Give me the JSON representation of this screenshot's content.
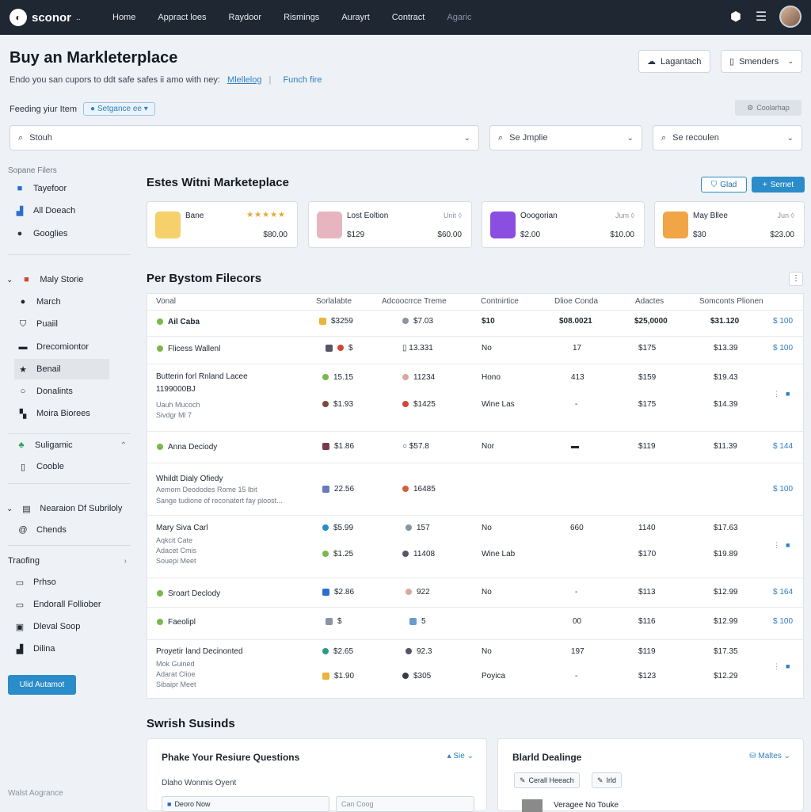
{
  "nav": {
    "brand": "sconor",
    "brand_suffix": "..",
    "links": [
      "Home",
      "Appract loes",
      "Raydoor",
      "Rismings",
      "Aurayrt",
      "Contract",
      "Agaric"
    ]
  },
  "header": {
    "title": "Buy an Markleterplace",
    "subtitle": "Endo you san cupors to ddt safe safes ii amo with ney:",
    "link1": "Mlellelog",
    "link2": "Funch fire",
    "btn1": "Lagantach",
    "btn2": "Smenders"
  },
  "filters": {
    "label": "Feeding yiur Item",
    "pill": "Setgance ee",
    "clear": "Coolarhap"
  },
  "search": {
    "s1": "Stouh",
    "s2": "Se Jmplie",
    "s3": "Se recoulen"
  },
  "sidebar": {
    "head1": "Sopane Filers",
    "items1": [
      "Tayefoor",
      "All Doeach",
      "Googlies"
    ],
    "group2": "Maly Storie",
    "items2": [
      "March",
      "Puaiil",
      "Drecomiontor",
      "Benail",
      "Donalints",
      "Moira Biorees"
    ],
    "group3": "Suligamic",
    "items3": [
      "Cooble"
    ],
    "group4": "Nearaion Df Subriloly",
    "items4": [
      "Chends"
    ],
    "head5": "Traofing",
    "items5": [
      "Prhso",
      "Endorall Folliober",
      "Dleval Soop",
      "Dilina"
    ],
    "button": "Ulid Autamot",
    "footer": "Walst Aogrance"
  },
  "market": {
    "title": "Estes Witni Marketeplace",
    "btn1": "Glad",
    "btn2": "Sernet",
    "cards": [
      {
        "name": "Bane",
        "tag": "★★★★★",
        "p1": "",
        "p2": "$80.00",
        "color": "#f3b23a"
      },
      {
        "name": "Lost Eoltion",
        "tag": "Unit ◊",
        "p1": "$129",
        "p2": "$60.00",
        "color": "#c9607a"
      },
      {
        "name": "Ooogorian",
        "tag": "Jum ◊",
        "p1": "$2.00",
        "p2": "$10.00",
        "color": "#8a3fd8"
      },
      {
        "name": "May Bllee",
        "tag": "Jun ◊",
        "p1": "$30",
        "p2": "$23.00",
        "color": "#e89a3a"
      }
    ]
  },
  "table": {
    "title": "Per Bystom Filecors",
    "headers": [
      "Vonal",
      "Sorlalabte",
      "Adcoocrrce Treme",
      "Contnirtice",
      "Dlioe Conda",
      "Adactes",
      "Somconts Plionen"
    ],
    "rows": [
      {
        "name": "Ail Caba",
        "c1": "$3259",
        "c2": "$7.03",
        "c3": "$10",
        "c4": "$08.0021",
        "c5": "$25,0000",
        "c6": "$31.120",
        "c7": "$ 100",
        "bold": true
      },
      {
        "name": "Flicess Wallenl",
        "c1": "$",
        "c2": "13.331",
        "c3": "No",
        "c4": "17",
        "c5": "$175",
        "c6": "$13.39",
        "c7": "$ 100"
      },
      {
        "name": "Butterin forl Rnland Lacee",
        "sub1": "1199000BJ",
        "sub2": "Uauh Mucoch",
        "sub3": "Sivdgr Ml 7",
        "c1": "15.15",
        "c2": "11234",
        "c3": "Hono",
        "c4": "413",
        "c5": "$159",
        "c6": "$19.43",
        "c1b": "$1.93",
        "c2b": "$1425",
        "c3b": "Wine Las",
        "c4b": "-",
        "c5b": "$175",
        "c6b": "$14.39"
      },
      {
        "name": "Anna Deciody",
        "c1": "$1.86",
        "c2": "$57.8",
        "c3": "Nor",
        "c4": "▬",
        "c5": "$119",
        "c6": "$11.39",
        "c7": "$ 144"
      },
      {
        "name": "Whildt Dialy Ofiedy",
        "sub1": "Aemom Deododes Rome 15 lbit",
        "sub2": "Sange tudione of reconatert fay ploost...",
        "c1": "22.56",
        "c2": "16485",
        "c7": "$ 100"
      },
      {
        "name": "Mary Siva Carl",
        "sub1": "Aqkcit Cate",
        "sub2": "Adacet Cmis",
        "sub3": "Souepi Meet",
        "c1": "$5.99",
        "c2": "157",
        "c3": "No",
        "c4": "660",
        "c5": "1140",
        "c6": "$17.63",
        "c1b": "$1.25",
        "c2b": "11408",
        "c3b": "Wine Lab",
        "c4b": "",
        "c5b": "$170",
        "c6b": "$19.89"
      },
      {
        "name": "Sroart Declody",
        "c1": "$2.86",
        "c2": "922",
        "c3": "No",
        "c4": "-",
        "c5": "$113",
        "c6": "$12.99",
        "c7": "$ 164"
      },
      {
        "name": "Faeolipl",
        "c1": "$",
        "c2": "5",
        "c3": "",
        "c4": "00",
        "c5": "$116",
        "c6": "$12.99",
        "c7": "$ 100"
      },
      {
        "name": "Proyetir land Decinonted",
        "sub1": "Mok Guined",
        "sub2": "Adarat Clioe",
        "sub3": "Sibaipr Meet",
        "c1": "$2.65",
        "c2": "92.3",
        "c3": "No",
        "c4": "197",
        "c5": "$119",
        "c6": "$17.35",
        "c1b": "$1.90",
        "c2b": "$305",
        "c3b": "Poyica",
        "c4b": "-",
        "c5b": "$123",
        "c6b": "$12.29"
      }
    ]
  },
  "bottom": {
    "title": "Swrish Susinds",
    "p1": {
      "title": "Phake Your Resiure Questions",
      "right": "Sie",
      "sub": "Dlaho Wonmis Oyent",
      "row1": "Deoro Now",
      "row2": "Can Coog"
    },
    "p2": {
      "title": "Blarld Dealinge",
      "right": "Maltes",
      "chip1": "Cerall Heeach",
      "chip2": "Irld",
      "row1": "Veragee No Touke"
    }
  },
  "colors": {
    "accent": "#2a8cc8",
    "nav_bg": "#1f2733",
    "link": "#2f7fc1"
  }
}
